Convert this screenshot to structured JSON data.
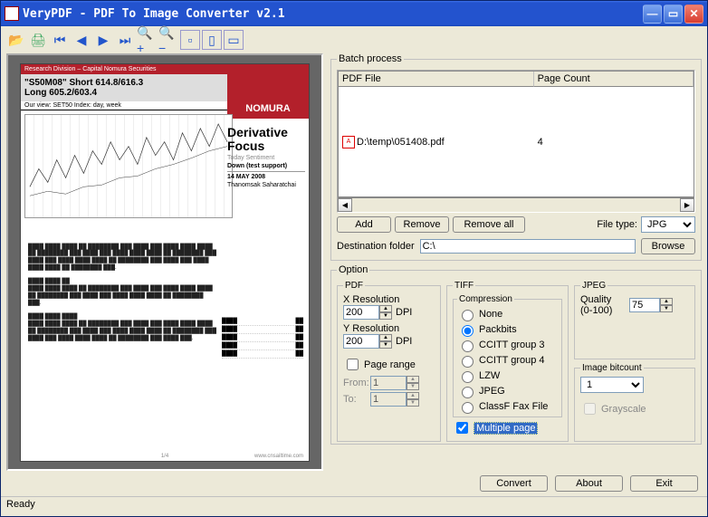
{
  "window": {
    "title": "VeryPDF - PDF To Image Converter v2.1"
  },
  "toolbar": {
    "open": "open",
    "print": "print",
    "first": "first",
    "prev": "prev",
    "next": "next",
    "last": "last",
    "zoomin": "zoom-in",
    "zoomout": "zoom-out",
    "actual": "actual",
    "fitpage": "fit-page",
    "fitwidth": "fit-width"
  },
  "batch": {
    "legend": "Batch process",
    "col_file": "PDF File",
    "col_pages": "Page Count",
    "rows": [
      {
        "path": "D:\\temp\\051408.pdf",
        "pages": "4"
      }
    ],
    "add": "Add",
    "remove": "Remove",
    "remove_all": "Remove all",
    "filetype_label": "File type:",
    "filetype_value": "JPG",
    "dest_label": "Destination folder",
    "dest_value": "C:\\",
    "browse": "Browse"
  },
  "option": {
    "legend": "Option",
    "pdf": {
      "legend": "PDF",
      "xres_label": "X Resolution",
      "xres_value": "200",
      "yres_label": "Y Resolution",
      "yres_value": "200",
      "dpi": "DPI",
      "page_range": "Page range",
      "from": "From:",
      "from_value": "1",
      "to": "To:",
      "to_value": "1"
    },
    "tiff": {
      "legend": "TIFF",
      "comp_legend": "Compression",
      "none": "None",
      "packbits": "Packbits",
      "ccitt3": "CCITT group 3",
      "ccitt4": "CCITT group 4",
      "lzw": "LZW",
      "jpeg": "JPEG",
      "classf": "ClassF Fax File",
      "multipage": "Multiple page"
    },
    "jpeg": {
      "legend": "JPEG",
      "quality_label": "Quality (0-100)",
      "quality_value": "75"
    },
    "bitcount": {
      "legend": "Image bitcount",
      "value": "1",
      "grayscale": "Grayscale"
    }
  },
  "buttons": {
    "convert": "Convert",
    "about": "About",
    "exit": "Exit"
  },
  "status": "Ready",
  "preview": {
    "banner": "Research Division – Capital Nomura Securities",
    "brand": "NOMURA",
    "headline1": "\"S50M08\" Short 614.8/616.3",
    "headline2": "Long 605.2/603.4",
    "ourview": "Our view: SET50 Index: day, week",
    "deriv_title": "Derivative Focus",
    "today_sent": "Today Sentiment",
    "sent_val": "Down (test support)",
    "pubdate": "14 MAY 2008",
    "analyst": "Thanomsak Saharatchai",
    "pagefooter_num": "1/4",
    "pagefooter_url": "www.cnsailtime.com"
  }
}
